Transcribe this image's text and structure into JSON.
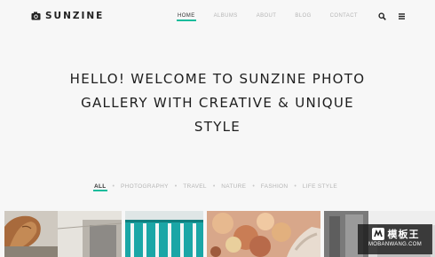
{
  "header": {
    "logo_text": "SUNZINE",
    "logo_icon": "camera-icon",
    "nav": [
      {
        "label": "HOME",
        "active": true
      },
      {
        "label": "ALBUMS",
        "active": false
      },
      {
        "label": "ABOUT",
        "active": false
      },
      {
        "label": "BLOG",
        "active": false
      },
      {
        "label": "CONTACT",
        "active": false
      }
    ],
    "icons": [
      "search-icon",
      "menu-icon"
    ]
  },
  "hero": {
    "title": "HELLO! WELCOME TO SUNZINE PHOTO GALLERY WITH CREATIVE & UNIQUE STYLE"
  },
  "filters": {
    "items": [
      {
        "label": "ALL",
        "active": true
      },
      {
        "label": "PHOTOGRAPHY",
        "active": false
      },
      {
        "label": "TRAVEL",
        "active": false
      },
      {
        "label": "NATURE",
        "active": false
      },
      {
        "label": "FASHION",
        "active": false
      },
      {
        "label": "LIFE STYLE",
        "active": false
      }
    ],
    "separator": "•"
  },
  "gallery": {
    "tiles": [
      {
        "name": "gallery-tile-bread"
      },
      {
        "name": "gallery-tile-teal-stripes"
      },
      {
        "name": "gallery-tile-flowers"
      },
      {
        "name": "gallery-tile-building"
      }
    ]
  },
  "watermark": {
    "title": "模板王",
    "url": "MOBANWANG.COM"
  },
  "colors": {
    "accent": "#1abc9c",
    "background": "#f7f7f7",
    "text_dark": "#1e1e1e",
    "text_muted": "#b5b5b5"
  }
}
